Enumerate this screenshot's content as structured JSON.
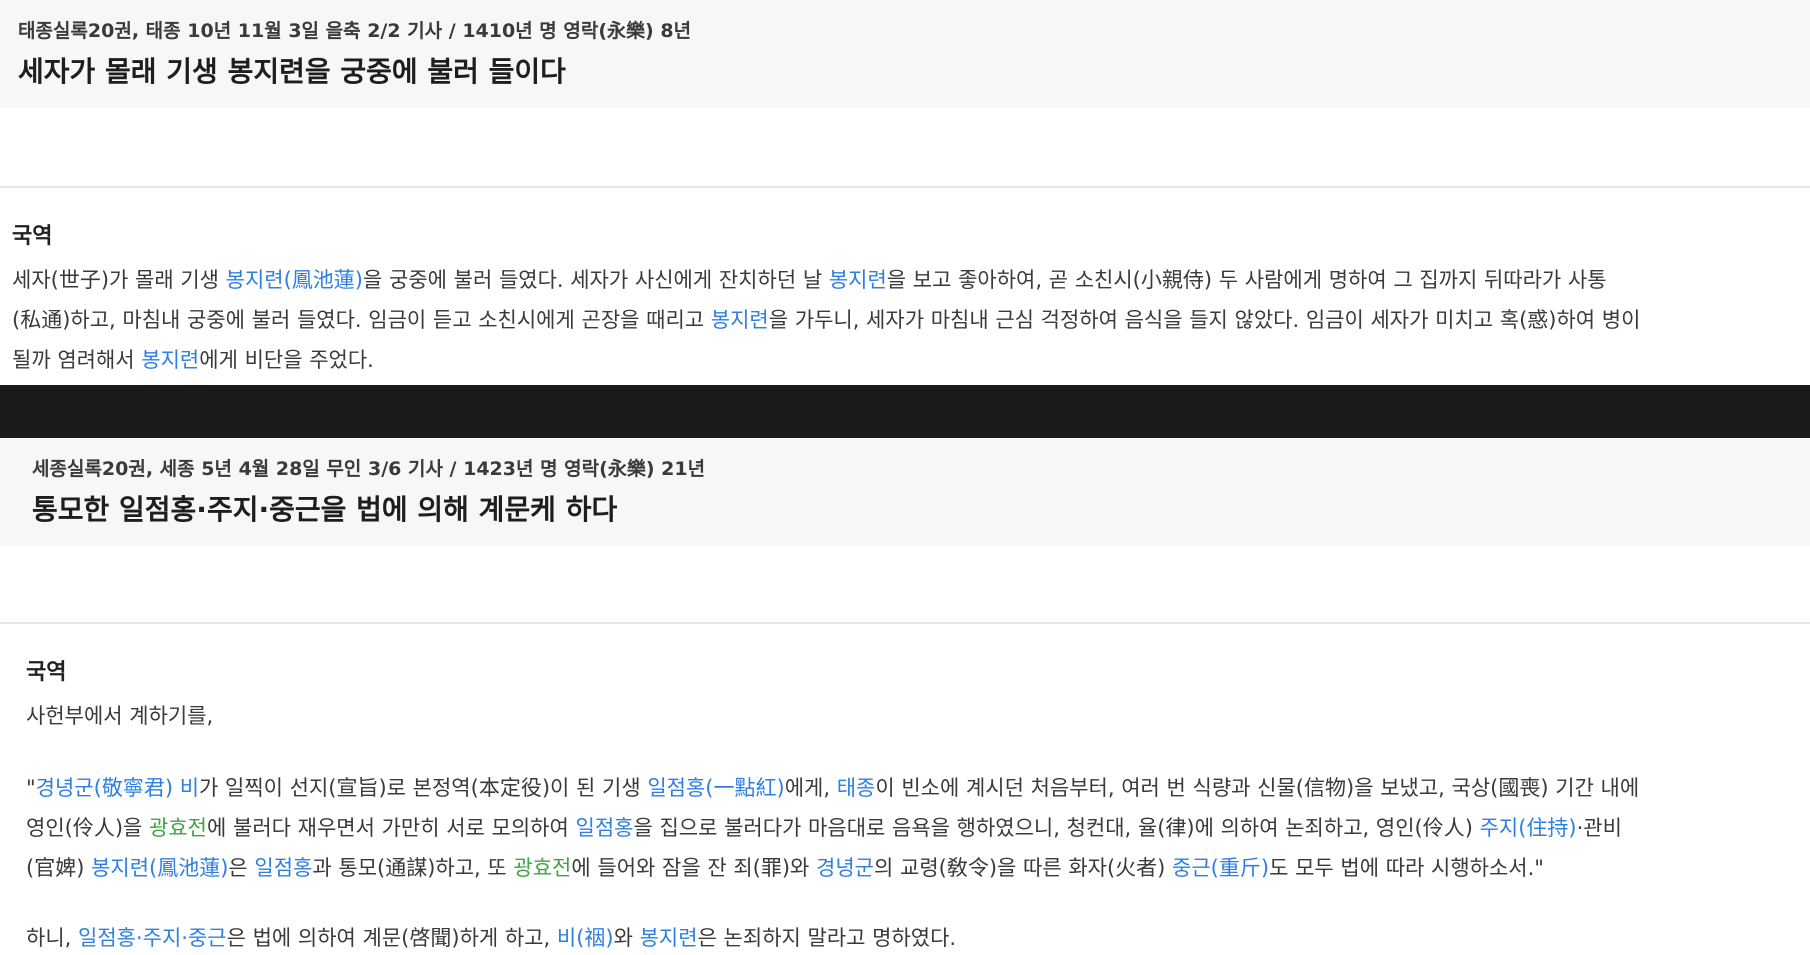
{
  "article1": {
    "meta": "태종실록20권, 태종 10년 11월 3일 을축 2/2 기사 / 1410년 명 영락(永樂) 8년",
    "title": "세자가 몰래 기생 봉지련을 궁중에 불러 들이다",
    "section_label": "국역",
    "body_lines": [
      [
        {
          "t": "세자(世子)가 몰래 기생 "
        },
        {
          "t": "봉지련(鳳池蓮)",
          "c": "blue"
        },
        {
          "t": "을 궁중에 불러 들였다. 세자가 사신에게 잔치하던 날 "
        },
        {
          "t": "봉지련",
          "c": "blue"
        },
        {
          "t": "을 보고 좋아하여, 곧 소친시(小親侍) 두 사람에게 명하여 그 집까지 뒤따라가 사통"
        }
      ],
      [
        {
          "t": "(私通)하고, 마침내 궁중에 불러 들였다. 임금이 듣고 소친시에게 곤장을 때리고 "
        },
        {
          "t": "봉지련",
          "c": "blue"
        },
        {
          "t": "을 가두니, 세자가 마침내 근심 걱정하여 음식을 들지 않았다. 임금이 세자가 미치고 혹(惑)하여 병이"
        }
      ],
      [
        {
          "t": "될까 염려해서 "
        },
        {
          "t": "봉지련",
          "c": "blue"
        },
        {
          "t": "에게 비단을 주었다."
        }
      ]
    ]
  },
  "article2": {
    "meta": "세종실록20권, 세종 5년 4월 28일 무인 3/6 기사 / 1423년 명 영락(永樂) 21년",
    "title": "통모한 일점홍·주지·중근을 법에 의해 계문케 하다",
    "section_label": "국역",
    "intro": "사헌부에서 계하기를,",
    "quote_lines": [
      [
        {
          "t": "\""
        },
        {
          "t": "경녕군(敬寧君) 비",
          "c": "blue"
        },
        {
          "t": "가 일찍이 선지(宣旨)로 본정역(本定役)이 된 기생 "
        },
        {
          "t": "일점홍(一點紅)",
          "c": "blue"
        },
        {
          "t": "에게, "
        },
        {
          "t": "태종",
          "c": "blue"
        },
        {
          "t": "이 빈소에 계시던 처음부터, 여러 번 식량과 신물(信物)을 보냈고, 국상(國喪) 기간 내에"
        }
      ],
      [
        {
          "t": "영인(伶人)을 "
        },
        {
          "t": "광효전",
          "c": "green"
        },
        {
          "t": "에 불러다 재우면서 가만히 서로 모의하여 "
        },
        {
          "t": "일점홍",
          "c": "blue"
        },
        {
          "t": "을 집으로 불러다가 마음대로 음욕을 행하였으니, 청컨대, 율(律)에 의하여 논죄하고, 영인(伶人) "
        },
        {
          "t": "주지(住持)",
          "c": "blue"
        },
        {
          "t": "·관비"
        }
      ],
      [
        {
          "t": "(官婢) "
        },
        {
          "t": "봉지련(鳳池蓮)",
          "c": "blue"
        },
        {
          "t": "은 "
        },
        {
          "t": "일점홍",
          "c": "blue"
        },
        {
          "t": "과 통모(通謀)하고, 또 "
        },
        {
          "t": "광효전",
          "c": "green"
        },
        {
          "t": "에 들어와 잠을 잔 죄(罪)와 "
        },
        {
          "t": "경녕군",
          "c": "blue"
        },
        {
          "t": "의 교령(敎令)을 따른 화자(火者) "
        },
        {
          "t": "중근(重斤)",
          "c": "blue"
        },
        {
          "t": "도 모두 법에 따라 시행하소서.\""
        }
      ]
    ],
    "closing_line": [
      {
        "t": "하니, "
      },
      {
        "t": "일점홍·주지·중근",
        "c": "blue"
      },
      {
        "t": "은 법에 의하여 계문(啓聞)하게 하고, "
      },
      {
        "t": "비(䄄)",
        "c": "blue"
      },
      {
        "t": "와 "
      },
      {
        "t": "봉지련",
        "c": "blue"
      },
      {
        "t": "은 논죄하지 말라고 명하였다."
      }
    ]
  }
}
